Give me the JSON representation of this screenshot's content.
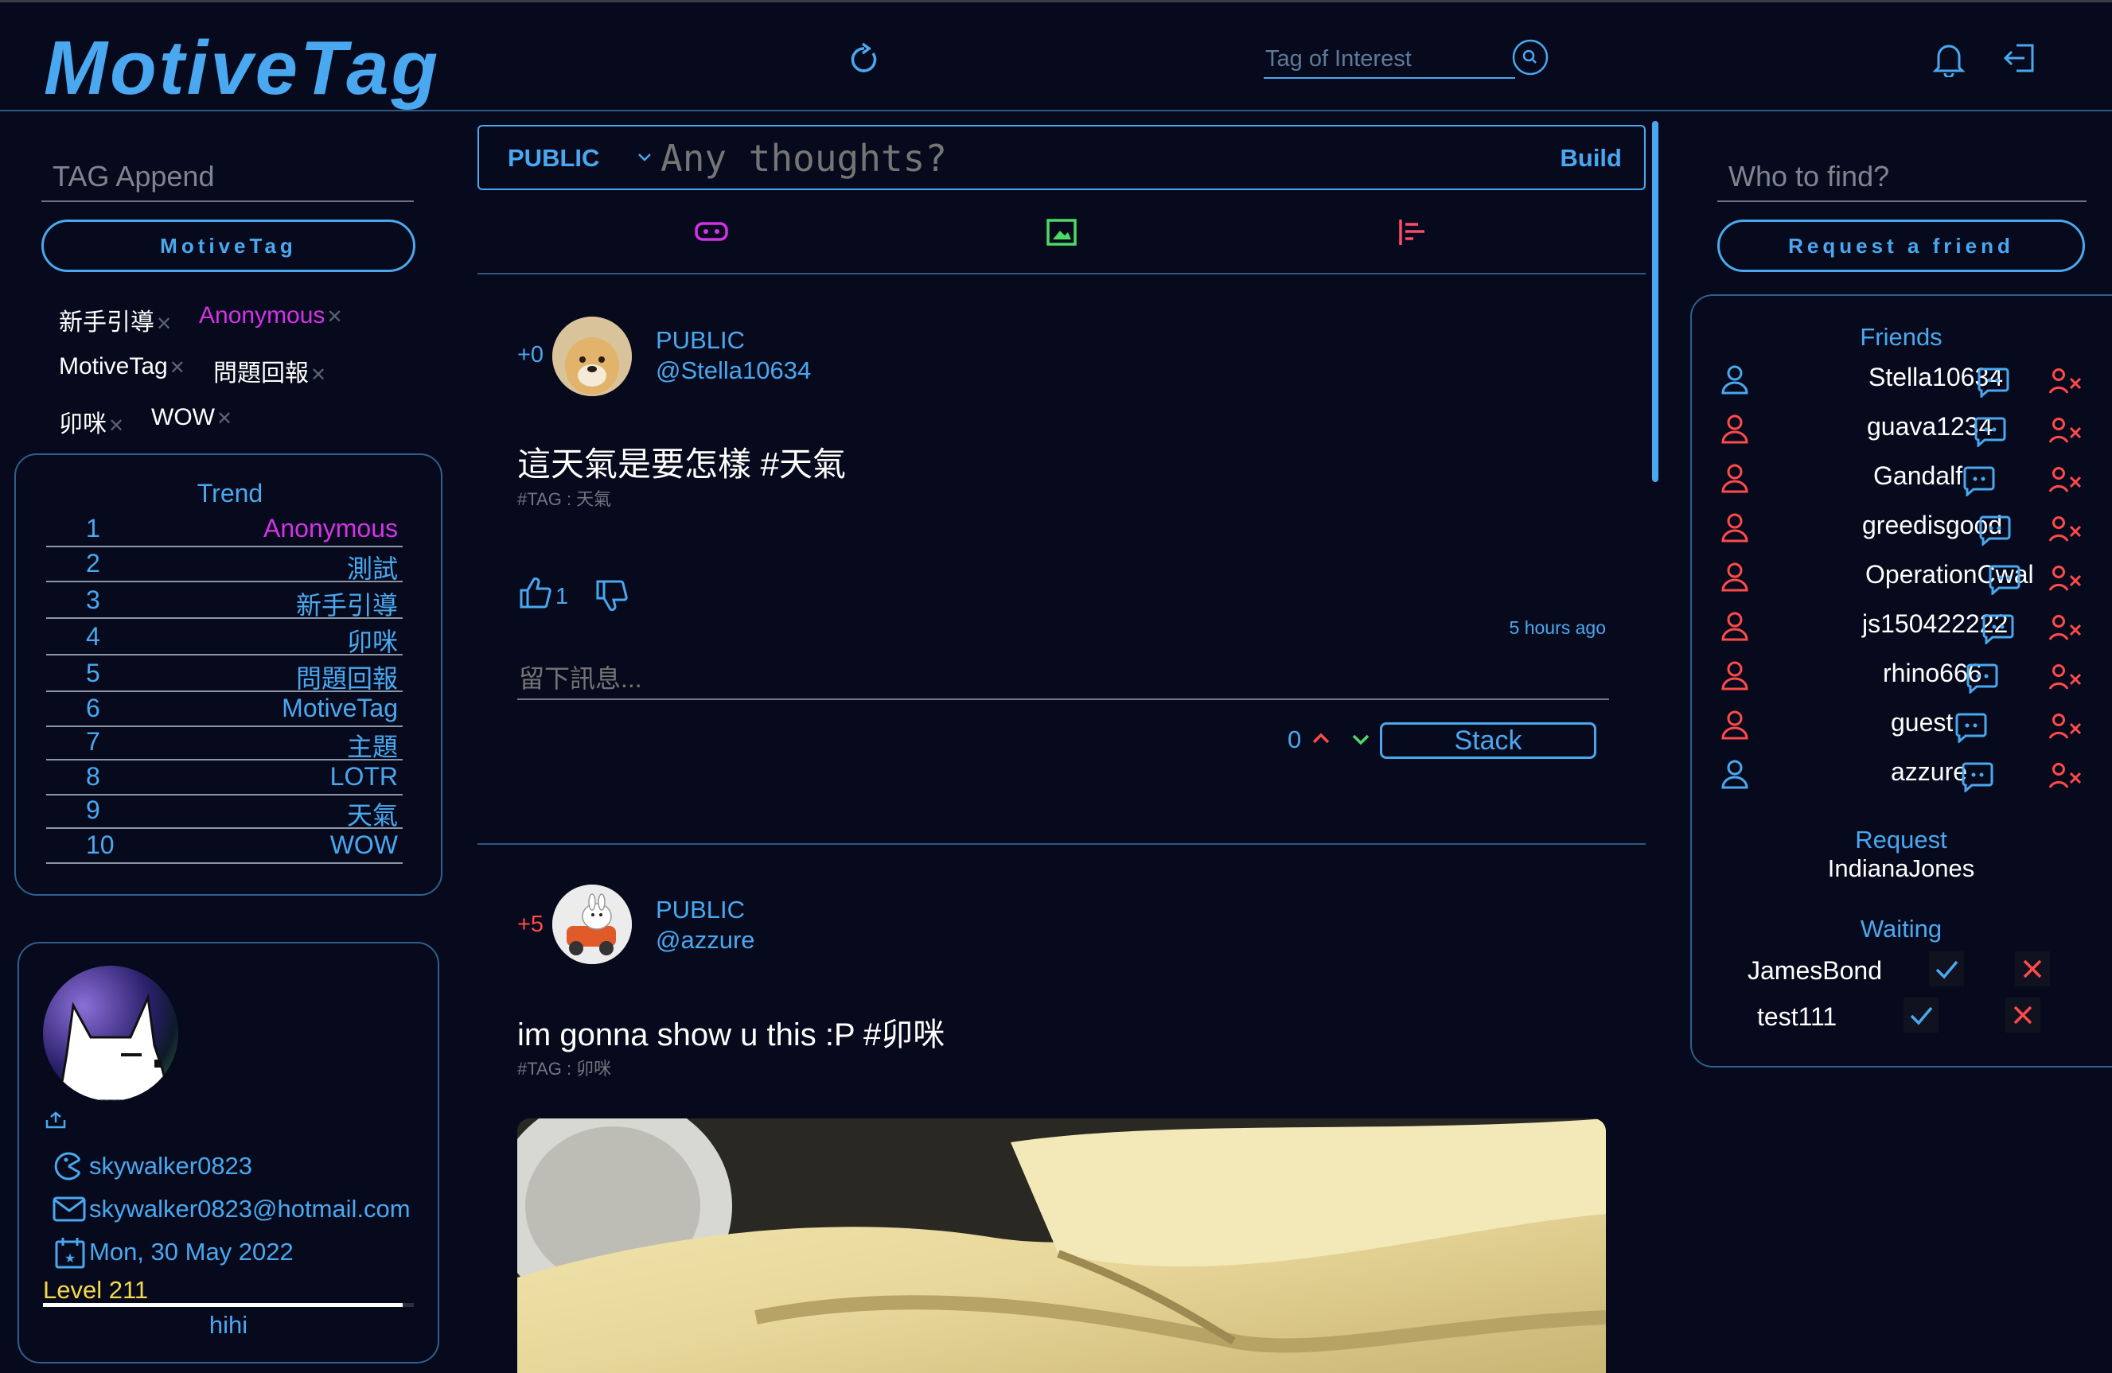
{
  "header": {
    "logo": "MotiveTag",
    "search_placeholder": "Tag of Interest"
  },
  "left": {
    "tag_append_placeholder": "TAG Append",
    "tag_button": "MotiveTag",
    "tags": [
      "新手引導",
      "Anonymous",
      "MotiveTag",
      "問題回報",
      "卯咪",
      "WOW"
    ],
    "trend": {
      "title": "Trend",
      "items": [
        {
          "rank": "1",
          "tag": "Anonymous"
        },
        {
          "rank": "2",
          "tag": "測試"
        },
        {
          "rank": "3",
          "tag": "新手引導"
        },
        {
          "rank": "4",
          "tag": "卯咪"
        },
        {
          "rank": "5",
          "tag": "問題回報"
        },
        {
          "rank": "6",
          "tag": "MotiveTag"
        },
        {
          "rank": "7",
          "tag": "主題"
        },
        {
          "rank": "8",
          "tag": "LOTR"
        },
        {
          "rank": "9",
          "tag": "天氣"
        },
        {
          "rank": "10",
          "tag": "WOW"
        }
      ]
    },
    "profile": {
      "username": "skywalker0823",
      "email": "skywalker0823@hotmail.com",
      "date": "Mon, 30 May 2022",
      "level": "Level 211",
      "level_progress": 0.97,
      "bio": "hihi"
    }
  },
  "composer": {
    "visibility": "PUBLIC",
    "placeholder": "Any thoughts?",
    "build": "Build"
  },
  "posts": [
    {
      "score": "+0",
      "visibility": "PUBLIC",
      "handle": "@Stella10634",
      "text": "這天氣是要怎樣 #天氣",
      "tag_line": "#TAG : 天氣",
      "likes": "1",
      "time": "5 hours ago",
      "comment_placeholder": "留下訊息...",
      "vote_count": "0",
      "stack": "Stack"
    },
    {
      "score": "+5",
      "visibility": "PUBLIC",
      "handle": "@azzure",
      "text": "im gonna show u this :P #卯咪",
      "tag_line": "#TAG : 卯咪"
    }
  ],
  "right": {
    "find_placeholder": "Who to find?",
    "request_button": "Request a friend",
    "friends_title": "Friends",
    "friends": [
      "Stella10634",
      "guava1234",
      "Gandalf",
      "greedisgood",
      "OperationCwal",
      "js150422222",
      "rhino666",
      "guest",
      "azzure"
    ],
    "request_title": "Request",
    "request_name": "IndianaJones",
    "waiting_title": "Waiting",
    "waiting": [
      "JamesBond",
      "test111"
    ]
  },
  "colors": {
    "background": "#070a1c",
    "accent": "#4aa8f0",
    "magenta": "#d333e8",
    "red": "#ff4a4a",
    "green": "#4cd964",
    "level_yellow": "#f5d94a"
  }
}
